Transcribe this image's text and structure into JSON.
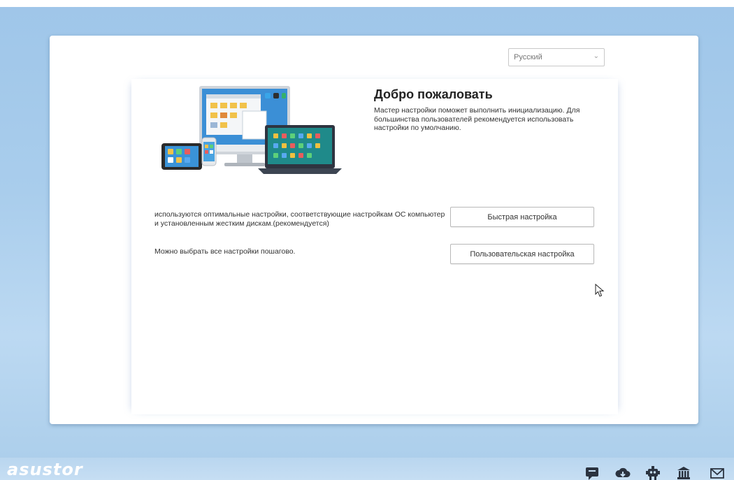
{
  "language_select": {
    "value": "Русский"
  },
  "welcome": {
    "title": "Добро пожаловать",
    "description": "Мастер настройки поможет выполнить инициализацию. Для большинства пользователей рекомендуется использовать настройки по умолчанию."
  },
  "options": [
    {
      "description": "используются оптимальные настройки, соответствующие настройкам ОС компьютер и установленным жестким дискам.(рекомендуется)",
      "button": "Быстрая настройка"
    },
    {
      "description": "Можно выбрать все настройки пошагово.",
      "button": "Пользовательская настройка"
    }
  ],
  "footer": {
    "logo": "asustor",
    "icons": [
      "chat-icon",
      "cloud-download-icon",
      "robot-icon",
      "bank-icon",
      "mail-icon"
    ]
  },
  "colors": {
    "background": "#a9cdec",
    "card": "#ffffff",
    "accent": "#1a9bd7"
  }
}
